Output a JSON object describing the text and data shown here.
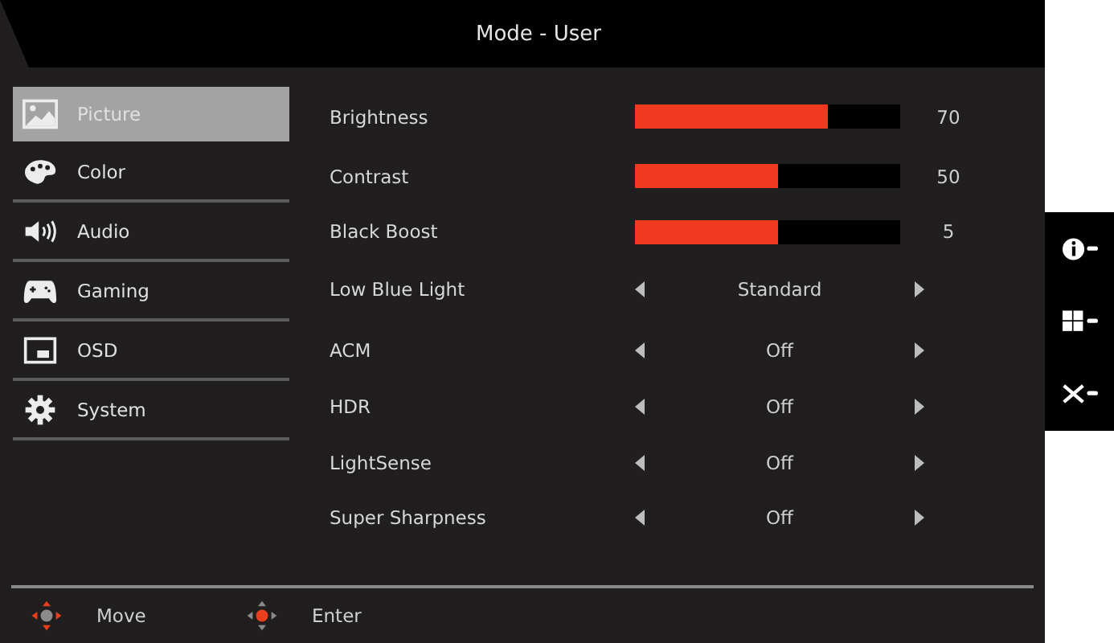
{
  "title": "Mode - User",
  "menu": [
    {
      "label": "Picture",
      "selected": true
    },
    {
      "label": "Color",
      "selected": false
    },
    {
      "label": "Audio",
      "selected": false
    },
    {
      "label": "Gaming",
      "selected": false
    },
    {
      "label": "OSD",
      "selected": false
    },
    {
      "label": "System",
      "selected": false
    }
  ],
  "settings": [
    {
      "kind": "slider",
      "label": "Brightness",
      "level": 0.73,
      "value": "70"
    },
    {
      "kind": "slider",
      "label": "Contrast",
      "level": 0.54,
      "value": "50"
    },
    {
      "kind": "slider",
      "label": "Black Boost",
      "level": 0.54,
      "value": "5"
    },
    {
      "kind": "option",
      "label": "Low Blue Light",
      "value": "Standard"
    },
    {
      "kind": "option",
      "label": "ACM",
      "value": "Off"
    },
    {
      "kind": "option",
      "label": "HDR",
      "value": "Off"
    },
    {
      "kind": "option",
      "label": "LightSense",
      "value": "Off"
    },
    {
      "kind": "option",
      "label": "Super Sharpness",
      "value": "Off"
    }
  ],
  "footer": [
    {
      "kind": "move",
      "label": "Move"
    },
    {
      "kind": "enter",
      "label": "Enter"
    }
  ],
  "keys": [
    {
      "kind": "info"
    },
    {
      "kind": "grid"
    },
    {
      "kind": "close"
    }
  ]
}
